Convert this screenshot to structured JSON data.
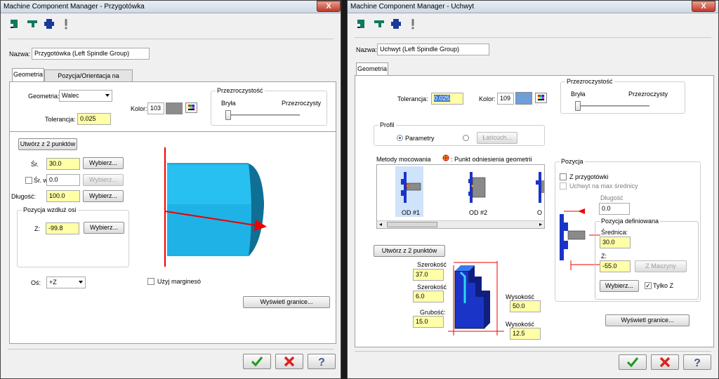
{
  "left": {
    "title": "Machine Component Manager - Przygotówka",
    "close": "X",
    "name_label": "Nazwa:",
    "name_value": "Przygotówka (Left Spindle Group)",
    "tabs": [
      "Geometria",
      "Pozycja/Orientacja na Maszynie"
    ],
    "geometry_label": "Geometria:",
    "geometry_value": "Walec",
    "tolerance_label": "Tolerancja:",
    "tolerance_value": "0.025",
    "color_label": "Kolor:",
    "color_value": "103",
    "transparency_title": "Przezroczystość",
    "solid_label": "Bryła",
    "transparent_label": "Przezroczysty",
    "create_two_points": "Utwórz z 2 punktów",
    "diameter_label": "Śr.",
    "diameter_value": "30.0",
    "inner_label": "Śr. w",
    "inner_value": "0.0",
    "length_label": "Długość:",
    "length_value": "100.0",
    "select_btn": "Wybierz...",
    "axis_pos_title": "Pozycja wzdłuż osi",
    "z_label": "Z:",
    "z_value": "-99.8",
    "axis_label": "Oś:",
    "axis_value": "+Z",
    "margins_label": "Użyj marginesó",
    "show_bounds": "Wyświetl granice..."
  },
  "right": {
    "title": "Machine Component Manager - Uchwyt",
    "close": "X",
    "name_label": "Nazwa:",
    "name_value": "Uchwyt (Left Spindle Group)",
    "tab": "Geometria",
    "tolerance_label": "Tolerancja:",
    "tolerance_value": "0.025",
    "color_label": "Kolor:",
    "color_value": "109",
    "transparency_title": "Przezroczystość",
    "solid_label": "Bryła",
    "transparent_label": "Przezroczysty",
    "profile_title": "Profil",
    "param_label": "Parametry",
    "chain_label": "Łańcuch...",
    "methods_label": "Metody mocowania",
    "ref_label": ": Punkt odniesienia geometrii",
    "methods": [
      "OD #1",
      "OD #2",
      "O"
    ],
    "create_two_points": "Utwórz z 2 punktów",
    "width_label": "Szerokość",
    "width_value": "37.0",
    "step_label": "Szerokość",
    "step_value": "6.0",
    "thick_label": "Grubość:",
    "thick_value": "15.0",
    "height1_label": "Wysokość",
    "height1_value": "50.0",
    "height2_label": "Wysokość",
    "height2_value": "12.5",
    "position_title": "Pozycja",
    "from_stock": "Z przygotówki",
    "max_diam": "Uchwyt na max średnicy",
    "length_label": "Długość",
    "length_value": "0.0",
    "defined_pos": "Pozycja definiowana",
    "diam_label": "Średnica:",
    "diam_value": "30.0",
    "z_label": "Z:",
    "z_value": "-55.0",
    "from_machine": "Z Maszyny",
    "select_btn": "Wybierz...",
    "only_z": "Tylko Z",
    "show_bounds": "Wyświetl granice..."
  },
  "colors": {
    "left_swatch": "#8c8c8c",
    "right_swatch": "#6f9fd8",
    "accent": "#ffffa8"
  }
}
